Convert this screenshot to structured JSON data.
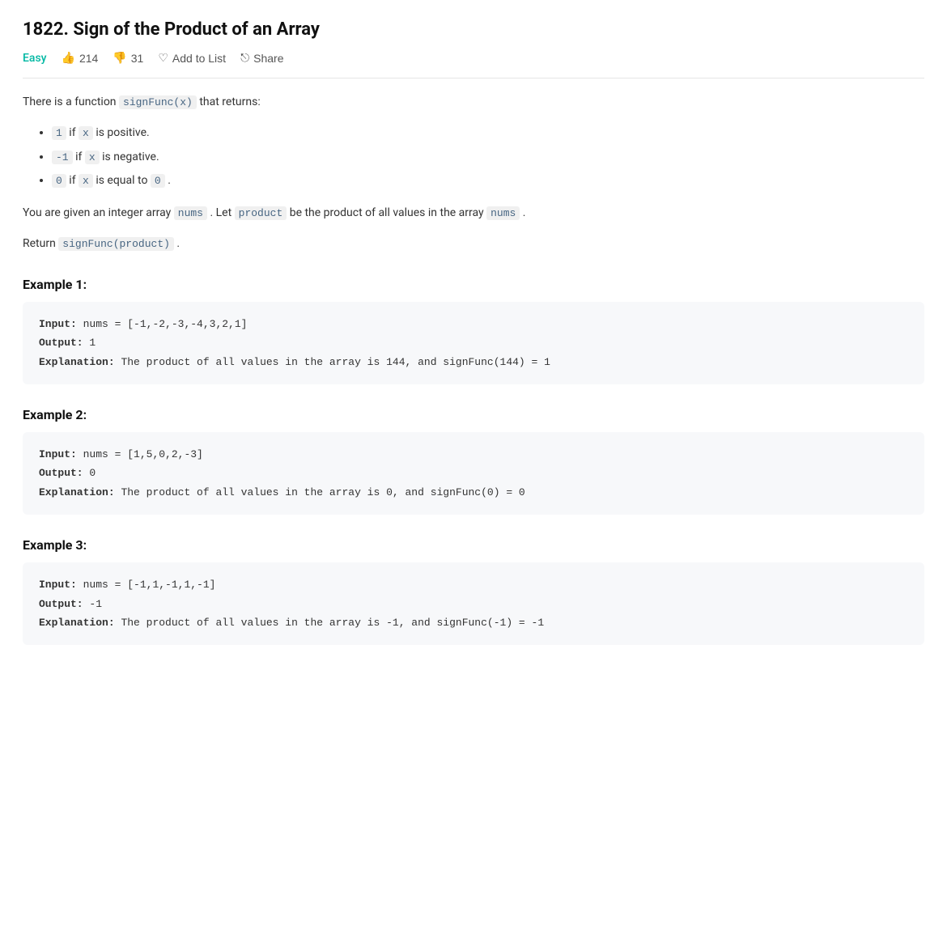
{
  "problem": {
    "number": "1822",
    "title": "1822. Sign of the Product of an Array",
    "difficulty": "Easy",
    "upvotes": "214",
    "downvotes": "31",
    "add_to_list_label": "Add to List",
    "share_label": "Share"
  },
  "description": {
    "intro": "There is a function",
    "signFunc_inline": "signFunc(x)",
    "intro_end": "that returns:",
    "bullets": [
      {
        "code": "1",
        "separator": "if",
        "var": "x",
        "text": "is positive."
      },
      {
        "code": "-1",
        "separator": "if",
        "var": "x",
        "text": "is negative."
      },
      {
        "code": "0",
        "separator": "if",
        "var": "x",
        "text": "is equal to",
        "end_code": "0",
        "period": "."
      }
    ],
    "para2_start": "You are given an integer array",
    "para2_nums": "nums",
    "para2_mid": ". Let",
    "para2_product": "product",
    "para2_end": "be the product of all values in the array",
    "para2_nums2": "nums",
    "para2_period": ".",
    "para3_start": "Return",
    "para3_code": "signFunc(product)",
    "para3_end": "."
  },
  "examples": [
    {
      "heading": "Example 1:",
      "input_label": "Input:",
      "input_value": "nums = [-1,-2,-3,-4,3,2,1]",
      "output_label": "Output:",
      "output_value": "1",
      "explanation_label": "Explanation:",
      "explanation_value": "The product of all values in the array is 144, and signFunc(144) = 1"
    },
    {
      "heading": "Example 2:",
      "input_label": "Input:",
      "input_value": "nums = [1,5,0,2,-3]",
      "output_label": "Output:",
      "output_value": "0",
      "explanation_label": "Explanation:",
      "explanation_value": "The product of all values in the array is 0, and signFunc(0) = 0"
    },
    {
      "heading": "Example 3:",
      "input_label": "Input:",
      "input_value": "nums = [-1,1,-1,1,-1]",
      "output_label": "Output:",
      "output_value": "-1",
      "explanation_label": "Explanation:",
      "explanation_value": "The product of all values in the array is -1, and signFunc(-1) = -1"
    }
  ],
  "icons": {
    "thumbup": "👍",
    "thumbdown": "👎",
    "heart": "♡",
    "share": "⎋"
  }
}
